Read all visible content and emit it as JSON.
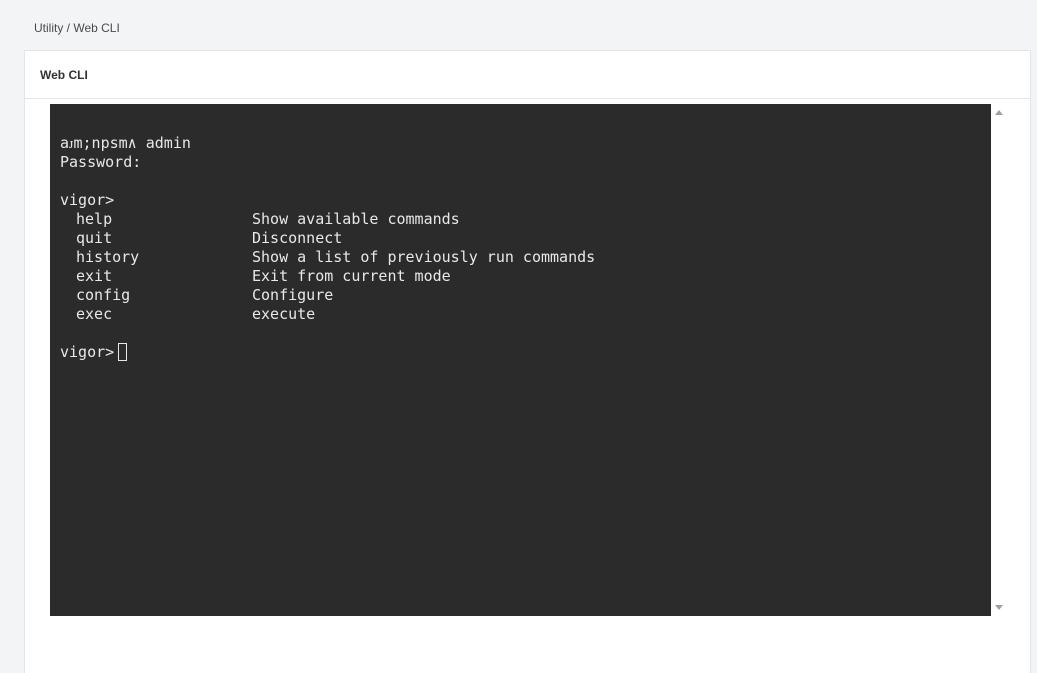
{
  "breadcrumb": "Utility / Web CLI",
  "panel": {
    "title": "Web CLI"
  },
  "terminal": {
    "login_line": "aᴊm;npsm∧ admin",
    "password_line": "Password:",
    "prompt_line": "vigor>",
    "commands": [
      {
        "name": "help",
        "description": "Show available commands"
      },
      {
        "name": "quit",
        "description": "Disconnect"
      },
      {
        "name": "history",
        "description": "Show a list of previously run commands"
      },
      {
        "name": "exit",
        "description": "Exit from current mode"
      },
      {
        "name": "config",
        "description": "Configure"
      },
      {
        "name": "exec",
        "description": "execute"
      }
    ],
    "current_prompt": "vigor>"
  },
  "icons": {
    "scroll_up": "triangle-up",
    "scroll_down": "triangle-down"
  }
}
